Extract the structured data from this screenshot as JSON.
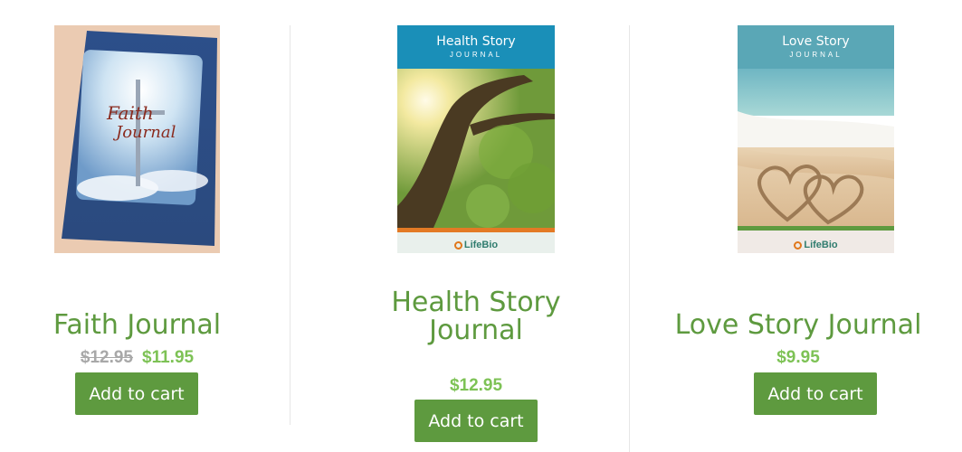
{
  "products": [
    {
      "name": "Faith Journal",
      "old_price": "$12.95",
      "price": "$11.95",
      "button": "Add to cart",
      "cover": {
        "heading": "Faith",
        "subheading": "Journal"
      }
    },
    {
      "name": "Health Story Journal",
      "price": "$12.95",
      "button": "Add to cart",
      "cover": {
        "heading": "Health Story",
        "subheading": "JOURNAL",
        "brand": "LifeBio"
      }
    },
    {
      "name": "Love Story Journal",
      "price": "$9.95",
      "button": "Add to cart",
      "cover": {
        "heading": "Love Story",
        "subheading": "JOURNAL",
        "brand": "LifeBio"
      }
    }
  ],
  "colors": {
    "accent": "#5e9a3f",
    "sale_price": "#7dc255",
    "old_price": "#a8a8a8"
  }
}
